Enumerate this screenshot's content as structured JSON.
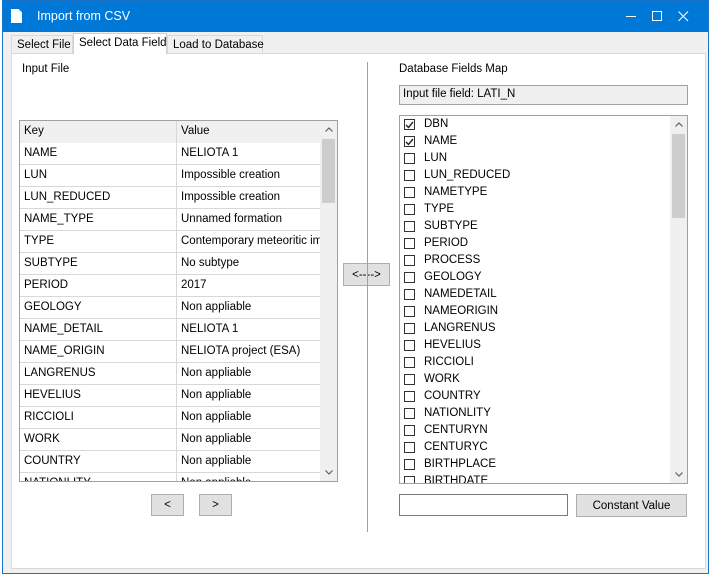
{
  "window": {
    "title": "Import from CSV",
    "controls": {
      "minimize": "─",
      "maximize": "☐",
      "close": "✕"
    }
  },
  "tabs": [
    {
      "label": "Select File"
    },
    {
      "label": "Select Data Field",
      "active": true
    },
    {
      "label": "Load to Database"
    }
  ],
  "left_panel": {
    "title": "Input File",
    "grid": {
      "columns": [
        "Key",
        "Value"
      ],
      "rows": [
        {
          "key": "NAME",
          "value": "NELIOTA 1"
        },
        {
          "key": "LUN",
          "value": "Impossible creation"
        },
        {
          "key": "LUN_REDUCED",
          "value": "Impossible creation"
        },
        {
          "key": "NAME_TYPE",
          "value": "Unnamed formation"
        },
        {
          "key": "TYPE",
          "value": "Contemporary meteoritic impa"
        },
        {
          "key": "SUBTYPE",
          "value": "No subtype"
        },
        {
          "key": "PERIOD",
          "value": "2017"
        },
        {
          "key": "GEOLOGY",
          "value": "Non appliable"
        },
        {
          "key": "NAME_DETAIL",
          "value": "NELIOTA 1"
        },
        {
          "key": "NAME_ORIGIN",
          "value": "NELIOTA project (ESA)"
        },
        {
          "key": "LANGRENUS",
          "value": "Non appliable"
        },
        {
          "key": "HEVELIUS",
          "value": "Non appliable"
        },
        {
          "key": "RICCIOLI",
          "value": "Non appliable"
        },
        {
          "key": "WORK",
          "value": "Non appliable"
        },
        {
          "key": "COUNTRY",
          "value": "Non appliable"
        },
        {
          "key": "NATIONLITY",
          "value": "Non appliable"
        }
      ]
    },
    "prev_label": "<",
    "next_label": ">"
  },
  "map_button_label": "<---->",
  "right_panel": {
    "title": "Database Fields Map",
    "input_field_label": "Input file field: LATI_N",
    "fields": [
      {
        "name": "DBN",
        "checked": true
      },
      {
        "name": "NAME",
        "checked": true
      },
      {
        "name": "LUN",
        "checked": false
      },
      {
        "name": "LUN_REDUCED",
        "checked": false
      },
      {
        "name": "NAMETYPE",
        "checked": false
      },
      {
        "name": "TYPE",
        "checked": false
      },
      {
        "name": "SUBTYPE",
        "checked": false
      },
      {
        "name": "PERIOD",
        "checked": false
      },
      {
        "name": "PROCESS",
        "checked": false
      },
      {
        "name": "GEOLOGY",
        "checked": false
      },
      {
        "name": "NAMEDETAIL",
        "checked": false
      },
      {
        "name": "NAMEORIGIN",
        "checked": false
      },
      {
        "name": "LANGRENUS",
        "checked": false
      },
      {
        "name": "HEVELIUS",
        "checked": false
      },
      {
        "name": "RICCIOLI",
        "checked": false
      },
      {
        "name": "WORK",
        "checked": false
      },
      {
        "name": "COUNTRY",
        "checked": false
      },
      {
        "name": "NATIONLITY",
        "checked": false
      },
      {
        "name": "CENTURYN",
        "checked": false
      },
      {
        "name": "CENTURYC",
        "checked": false
      },
      {
        "name": "BIRTHPLACE",
        "checked": false
      },
      {
        "name": "BIRTHDATE",
        "checked": false
      }
    ],
    "constant_value_input": "",
    "constant_value_button": "Constant Value"
  },
  "colors": {
    "titlebar": "#0078d7",
    "window_bg": "#f0f0f0",
    "button_bg": "#e1e1e1"
  }
}
